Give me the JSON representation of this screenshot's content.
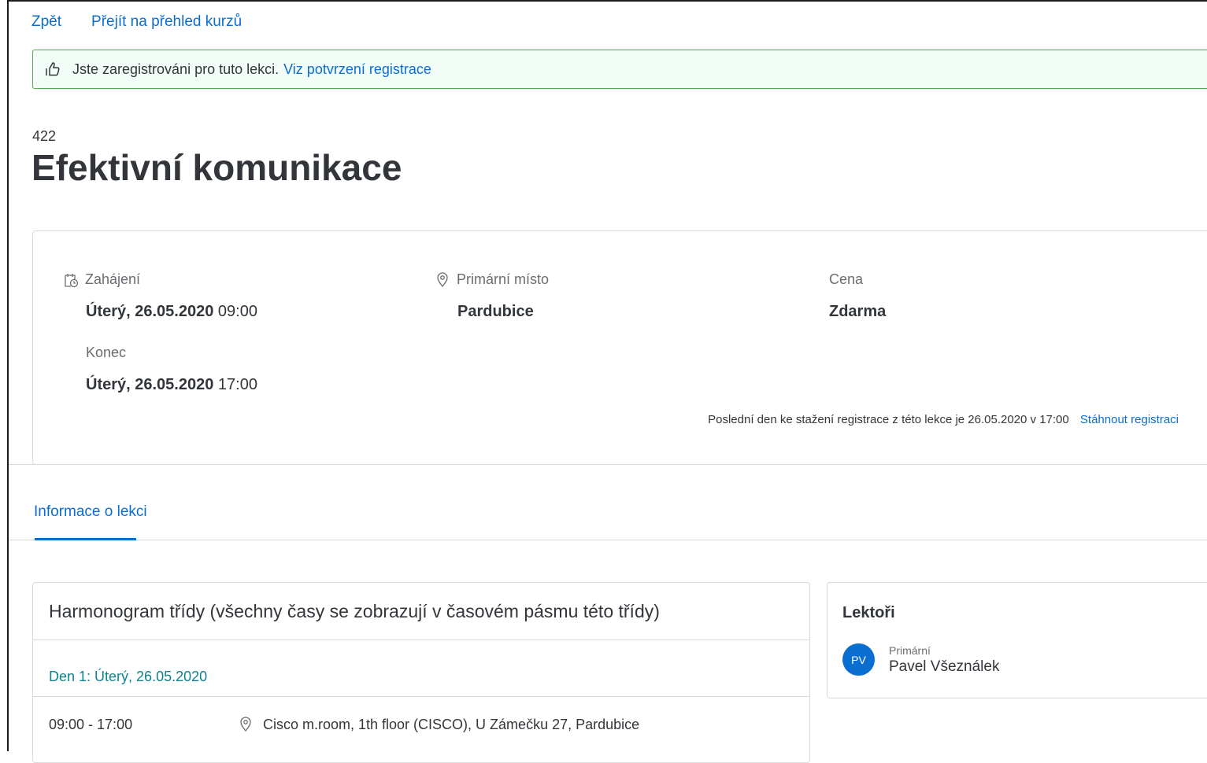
{
  "nav": {
    "back": "Zpět",
    "overview": "Přejít na přehled kurzů"
  },
  "banner": {
    "message": "Jste zaregistrováni pro tuto lekci.",
    "link": "Viz potvrzení registrace",
    "icon": "thumbs-up-icon"
  },
  "course": {
    "id": "422",
    "title": "Efektivní komunikace"
  },
  "details": {
    "start_label": "Zahájení",
    "start_date": "Úterý, 26.05.2020",
    "start_time": "09:00",
    "end_label": "Konec",
    "end_date": "Úterý, 26.05.2020",
    "end_time": "17:00",
    "location_label": "Primární místo",
    "location_value": "Pardubice",
    "price_label": "Cena",
    "price_value": "Zdarma",
    "deadline_text": "Poslední den ke stažení registrace z této lekce je 26.05.2020 v 17:00",
    "withdraw_link": "Stáhnout registraci"
  },
  "tabs": [
    {
      "label": "Informace o lekci",
      "selected": true
    }
  ],
  "schedule": {
    "title": "Harmonogram třídy (všechny časy se zobrazují v časovém pásmu této třídy)",
    "day": "Den 1: Úterý, 26.05.2020",
    "slot_time": "09:00 - 17:00",
    "slot_location": "Cisco m.room, 1th floor (CISCO), U Zámečku 27, Pardubice"
  },
  "lectors": {
    "heading": "Lektoři",
    "items": [
      {
        "initials": "PV",
        "role": "Primární",
        "name": "Pavel Všeználek"
      }
    ]
  },
  "colors": {
    "accent": "#0a6ed1",
    "success_border": "#4caf50",
    "success_bg": "#f1fdf6",
    "day_teal": "#0f828f"
  }
}
